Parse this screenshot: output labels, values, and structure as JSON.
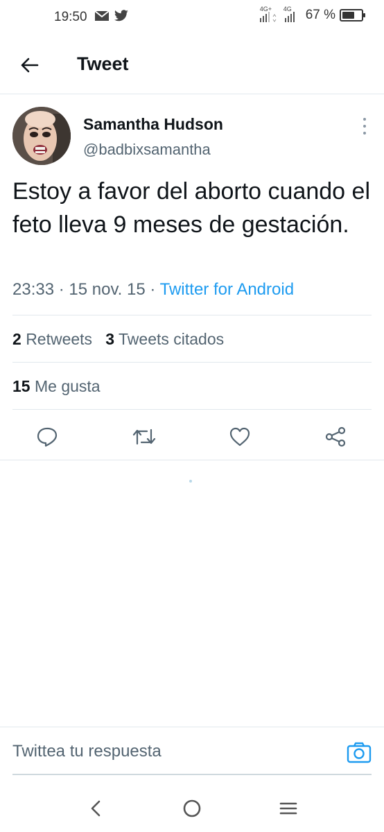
{
  "status_bar": {
    "time": "19:50",
    "network_1": "4G+",
    "network_2": "4G",
    "battery_percent": "67 %",
    "battery_level": 0.67
  },
  "header": {
    "back_icon": "arrow-left-icon",
    "title": "Tweet"
  },
  "tweet": {
    "author": {
      "display_name": "Samantha Hudson",
      "handle": "@badbixsamantha"
    },
    "text": "Estoy a favor del aborto cuando el feto lleva 9 meses de gestación.",
    "time": "23:33",
    "date": "15 nov. 15",
    "source": "Twitter for Android",
    "separator": "·",
    "stats": {
      "retweets_count": "2",
      "retweets_label": "Retweets",
      "quotes_count": "3",
      "quotes_label": "Tweets citados",
      "likes_count": "15",
      "likes_label": "Me gusta"
    },
    "actions": [
      "reply-icon",
      "retweet-icon",
      "heart-icon",
      "share-icon"
    ]
  },
  "reply": {
    "placeholder": "Twittea tu respuesta",
    "camera_icon": "camera-icon"
  },
  "colors": {
    "accent": "#1d9bf0",
    "text_primary": "#0f1419",
    "text_secondary": "#536471",
    "divider": "#e1e8ed"
  }
}
